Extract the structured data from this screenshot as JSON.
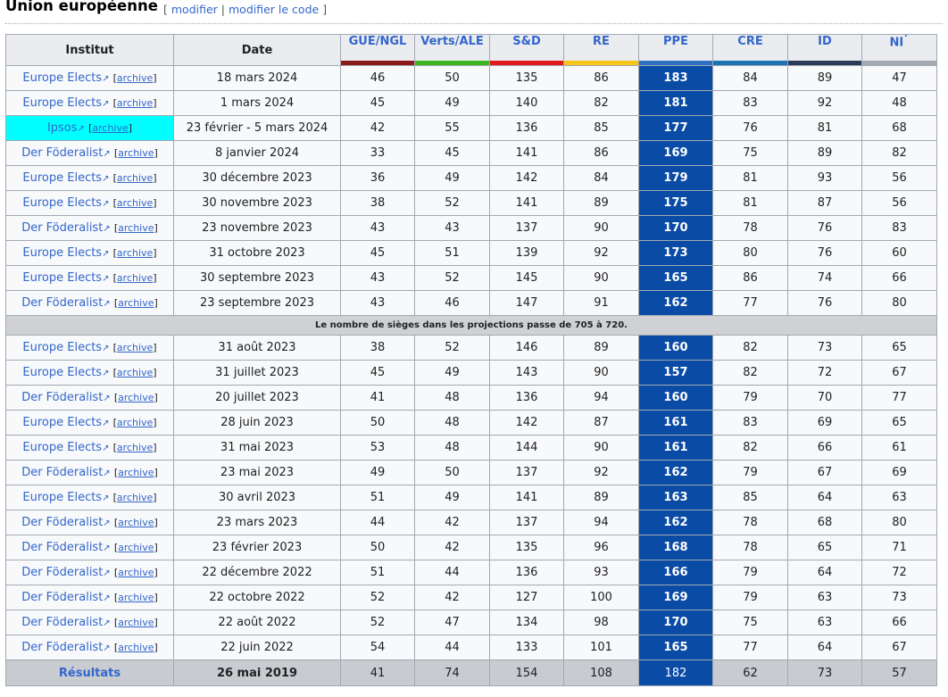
{
  "section": {
    "title": "Union européenne",
    "bracket_open": "[",
    "edit_label": "modifier",
    "separator": "|",
    "edit_code_label": "modifier le code",
    "bracket_close": "]"
  },
  "table": {
    "headers": {
      "institut": "Institut",
      "date": "Date"
    },
    "parties": [
      {
        "label": "GUE/NGL",
        "color": "#8b1a1a",
        "sup": ""
      },
      {
        "label": "Verts/ALE",
        "color": "#3cb521",
        "sup": ""
      },
      {
        "label": "S&D",
        "color": "#e21a1a",
        "sup": ""
      },
      {
        "label": "RE",
        "color": "#f5c518",
        "sup": ""
      },
      {
        "label": "PPE",
        "color": "#2f6fc2",
        "sup": ""
      },
      {
        "label": "CRE",
        "color": "#1b73b3",
        "sup": ""
      },
      {
        "label": "ID",
        "color": "#2b3b5b",
        "sup": ""
      },
      {
        "label": "NI",
        "color": "#a2a9b1",
        "sup": "7"
      }
    ],
    "archive_label": "archive",
    "ext_icon": "↗",
    "note": "Le nombre de sièges dans les projections passe de 705 à 720.",
    "note_after_row": 9,
    "rows": [
      {
        "institut": "Europe Elects",
        "date": "18 mars 2024",
        "values": [
          "46",
          "50",
          "135",
          "86",
          "183",
          "84",
          "89",
          "47"
        ],
        "highlight": false
      },
      {
        "institut": "Europe Elects",
        "date": "1 mars 2024",
        "values": [
          "45",
          "49",
          "140",
          "82",
          "181",
          "83",
          "92",
          "48"
        ],
        "highlight": false
      },
      {
        "institut": "Ipsos",
        "date": "23 février - 5 mars 2024",
        "values": [
          "42",
          "55",
          "136",
          "85",
          "177",
          "76",
          "81",
          "68"
        ],
        "highlight": true
      },
      {
        "institut": "Der Föderalist",
        "date": "8 janvier 2024",
        "values": [
          "33",
          "45",
          "141",
          "86",
          "169",
          "75",
          "89",
          "82"
        ],
        "highlight": false
      },
      {
        "institut": "Europe Elects",
        "date": "30 décembre 2023",
        "values": [
          "36",
          "49",
          "142",
          "84",
          "179",
          "81",
          "93",
          "56"
        ],
        "highlight": false
      },
      {
        "institut": "Europe Elects",
        "date": "30 novembre 2023",
        "values": [
          "38",
          "52",
          "141",
          "89",
          "175",
          "81",
          "87",
          "56"
        ],
        "highlight": false
      },
      {
        "institut": "Der Föderalist",
        "date": "23 novembre 2023",
        "values": [
          "43",
          "43",
          "137",
          "90",
          "170",
          "78",
          "76",
          "83"
        ],
        "highlight": false
      },
      {
        "institut": "Europe Elects",
        "date": "31 octobre 2023",
        "values": [
          "45",
          "51",
          "139",
          "92",
          "173",
          "80",
          "76",
          "60"
        ],
        "highlight": false
      },
      {
        "institut": "Europe Elects",
        "date": "30 septembre 2023",
        "values": [
          "43",
          "52",
          "145",
          "90",
          "165",
          "86",
          "74",
          "66"
        ],
        "highlight": false
      },
      {
        "institut": "Der Föderalist",
        "date": "23 septembre 2023",
        "values": [
          "43",
          "46",
          "147",
          "91",
          "162",
          "77",
          "76",
          "80"
        ],
        "highlight": false
      },
      {
        "institut": "Europe Elects",
        "date": "31 août 2023",
        "values": [
          "38",
          "52",
          "146",
          "89",
          "160",
          "82",
          "73",
          "65"
        ],
        "highlight": false
      },
      {
        "institut": "Europe Elects",
        "date": "31 juillet 2023",
        "values": [
          "45",
          "49",
          "143",
          "90",
          "157",
          "82",
          "72",
          "67"
        ],
        "highlight": false
      },
      {
        "institut": "Der Föderalist",
        "date": "20 juillet 2023",
        "values": [
          "41",
          "48",
          "136",
          "94",
          "160",
          "79",
          "70",
          "77"
        ],
        "highlight": false
      },
      {
        "institut": "Europe Elects",
        "date": "28 juin 2023",
        "values": [
          "50",
          "48",
          "142",
          "87",
          "161",
          "83",
          "69",
          "65"
        ],
        "highlight": false
      },
      {
        "institut": "Europe Elects",
        "date": "31 mai 2023",
        "values": [
          "53",
          "48",
          "144",
          "90",
          "161",
          "82",
          "66",
          "61"
        ],
        "highlight": false
      },
      {
        "institut": "Der Föderalist",
        "date": "23 mai 2023",
        "values": [
          "49",
          "50",
          "137",
          "92",
          "162",
          "79",
          "67",
          "69"
        ],
        "highlight": false
      },
      {
        "institut": "Europe Elects",
        "date": "30 avril 2023",
        "values": [
          "51",
          "49",
          "141",
          "89",
          "163",
          "85",
          "64",
          "63"
        ],
        "highlight": false
      },
      {
        "institut": "Der Föderalist",
        "date": "23 mars 2023",
        "values": [
          "44",
          "42",
          "137",
          "94",
          "162",
          "78",
          "68",
          "80"
        ],
        "highlight": false
      },
      {
        "institut": "Der Föderalist",
        "date": "23 février 2023",
        "values": [
          "50",
          "42",
          "135",
          "96",
          "168",
          "78",
          "65",
          "71"
        ],
        "highlight": false
      },
      {
        "institut": "Der Föderalist",
        "date": "22 décembre 2022",
        "values": [
          "51",
          "44",
          "136",
          "93",
          "166",
          "79",
          "64",
          "72"
        ],
        "highlight": false
      },
      {
        "institut": "Der Föderalist",
        "date": "22 octobre 2022",
        "values": [
          "52",
          "42",
          "127",
          "100",
          "169",
          "79",
          "63",
          "73"
        ],
        "highlight": false
      },
      {
        "institut": "Der Föderalist",
        "date": "22 août 2022",
        "values": [
          "52",
          "47",
          "134",
          "98",
          "170",
          "75",
          "63",
          "66"
        ],
        "highlight": false
      },
      {
        "institut": "Der Föderalist",
        "date": "22 juin 2022",
        "values": [
          "54",
          "44",
          "133",
          "101",
          "165",
          "77",
          "64",
          "67"
        ],
        "highlight": false
      }
    ],
    "results": {
      "label": "Résultats",
      "date": "26 mai 2019",
      "values": [
        "41",
        "74",
        "154",
        "108",
        "182",
        "62",
        "73",
        "57"
      ]
    },
    "lead_column": 4
  }
}
